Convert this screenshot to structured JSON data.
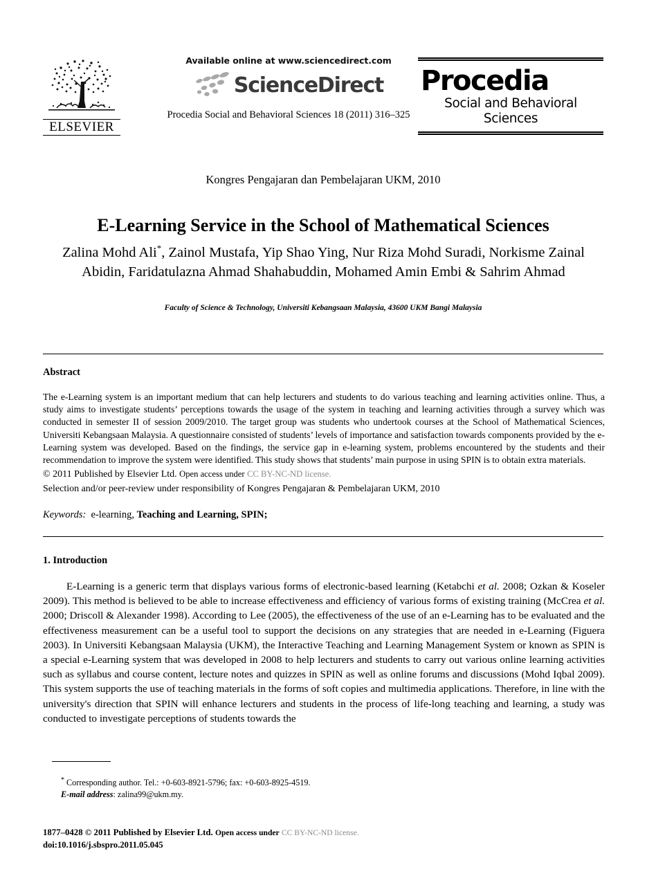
{
  "masthead": {
    "publisher_logo": "elsevier-tree-logo",
    "publisher_name": "ELSEVIER",
    "available_online": "Available online at www.sciencedirect.com",
    "sciencedirect_wordmark": "ScienceDirect",
    "citation_line": "Procedia Social and Behavioral Sciences 18 (2011) 316–325",
    "journal_title": "Procedia",
    "journal_subtitle": "Social and Behavioral Sciences"
  },
  "title_block": {
    "conference": "Kongres Pengajaran dan Pembelajaran UKM, 2010",
    "title": "E-Learning Service in the School of Mathematical Sciences",
    "authors": "Zalina Mohd Ali*, Zainol Mustafa, Yip Shao Ying, Nur Riza Mohd Suradi, Norkisme Zainal Abidin, Faridatulazna Ahmad Shahabuddin, Mohamed Amin Embi & Sahrim Ahmad",
    "authors_line1_pre": "Zalina Mohd Ali",
    "authors_corresponding_mark": "*",
    "authors_line1_post": ", Zainol Mustafa, Yip Shao Ying, Nur Riza Mohd Suradi, Norkisme",
    "authors_line2": "Zainal Abidin, Faridatulazna Ahmad Shahabuddin, Mohamed Amin Embi & Sahrim",
    "authors_line3": "Ahmad",
    "affiliation": "Faculty of Science & Technology, Universiti Kebangsaan Malaysia, 43600 UKM Bangi  Malaysia"
  },
  "abstract": {
    "heading": "Abstract",
    "body": "The e-Learning system is an important medium that can help lecturers and students to do various teaching and learning activities online. Thus, a study aims to investigate students’ perceptions towards the usage of the system in teaching and learning activities through a survey which was conducted in semester II of session 2009/2010. The target group was students who undertook courses at the School of Mathematical Sciences, Universiti Kebangsaan Malaysia. A questionnaire consisted of students’ levels of importance and satisfaction towards components provided by the e-Learning system was developed. Based on the findings, the service gap in e-learning system, problems encountered by the students and their recommendation to improve the system were identified.  This study shows that students’ main purpose in using SPIN is to obtain extra materials.",
    "copyright_prefix": "© 2011 Published by Elsevier Ltd.",
    "open_access_text": "Open access under",
    "license_link": "CC BY-NC-ND license.",
    "peer_review": "Selection and/or peer-review under responsibility of Kongres Pengajaran & Pembelajaran UKM, 2010",
    "keywords_label": "Keywords:",
    "keywords_plain": "e-learning,",
    "keywords_bold": "Teaching and Learning,",
    "keywords_tail": "SPIN;"
  },
  "introduction": {
    "heading": "1. Introduction",
    "body_part1": "E-Learning is a generic term that displays various forms of electronic-based learning (Ketabchi ",
    "body_italic1": "et al.",
    "body_part2": " 2008; Ozkan & Koseler 2009). This method is believed to be able to increase effectiveness and efficiency of various forms of existing training (McCrea ",
    "body_italic2": "et al.",
    "body_part3": " 2000; Driscoll & Alexander 1998).  According to Lee (2005), the effectiveness of the use of an e-Learning has to be evaluated and the effectiveness measurement can be a useful tool to support the decisions on any strategies that are needed in e-Learning (Figuera 2003). In Universiti Kebangsaan Malaysia (UKM), the Interactive Teaching and Learning Management System or known as SPIN is a special e-Learning system that was developed in 2008 to help lecturers and students to carry out various online learning activities such as syllabus and course content, lecture notes and quizzes in SPIN as well as online forums and discussions (Mohd Iqbal 2009). This system supports the use of teaching materials in the forms of soft copies and multimedia applications. Therefore, in line with the university's direction that SPIN will enhance lecturers and students in the process of life-long teaching and learning, a study was conducted to investigate perceptions of students towards the"
  },
  "footnote": {
    "marker": "*",
    "corresponding": " Corresponding author. Tel.: +0-603-8921-5796; fax: +0-603-8925-4519.",
    "email_label": "E-mail address",
    "email_value": ": zalina99@ukm.my."
  },
  "page_footer": {
    "issn_copyright": "1877–0428 © 2011 Published by Elsevier Ltd.",
    "open_access_text": "Open access under",
    "license_link": "CC BY-NC-ND license.",
    "doi": "doi:10.1016/j.sbspro.2011.05.045"
  },
  "colors": {
    "text": "#000000",
    "license_link": "#8a8a8a",
    "sciencedirect_word": "#3a3a3a",
    "page_background": "#ffffff"
  }
}
